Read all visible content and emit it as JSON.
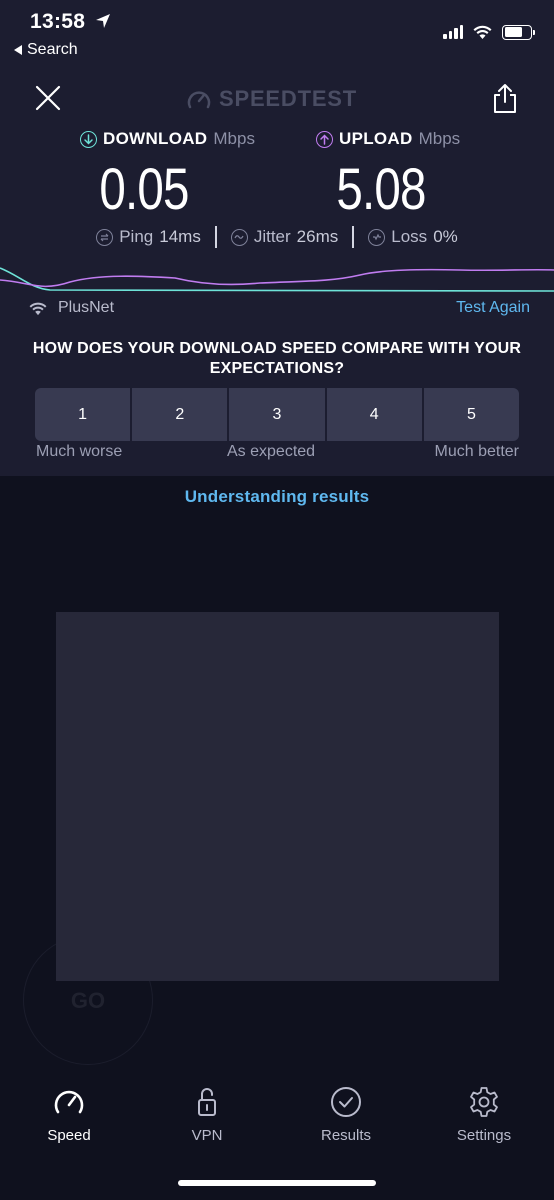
{
  "status_bar": {
    "time": "13:58",
    "back_label": "Search"
  },
  "header": {
    "logo_text": "SPEEDTEST"
  },
  "results": {
    "download": {
      "label": "DOWNLOAD",
      "unit": "Mbps",
      "value": "0.05"
    },
    "upload": {
      "label": "UPLOAD",
      "unit": "Mbps",
      "value": "5.08"
    },
    "ping": {
      "label": "Ping",
      "value": "14",
      "unit": "ms"
    },
    "jitter": {
      "label": "Jitter",
      "value": "26",
      "unit": "ms"
    },
    "loss": {
      "label": "Loss",
      "value": "0",
      "unit": "%"
    }
  },
  "network": {
    "isp": "PlusNet",
    "test_again": "Test Again"
  },
  "survey": {
    "question": "HOW DOES YOUR DOWNLOAD SPEED COMPARE WITH YOUR EXPECTATIONS?",
    "options": [
      "1",
      "2",
      "3",
      "4",
      "5"
    ],
    "label_low": "Much worse",
    "label_mid": "As expected",
    "label_high": "Much better"
  },
  "links": {
    "understanding": "Understanding results"
  },
  "ghost": {
    "go": "GO"
  },
  "tabs": {
    "speed": "Speed",
    "vpn": "VPN",
    "results": "Results",
    "settings": "Settings"
  },
  "colors": {
    "download_accent": "#6ee3d8",
    "upload_accent": "#c07cf0",
    "link": "#5fb8ef",
    "background": "#1c1d30"
  }
}
